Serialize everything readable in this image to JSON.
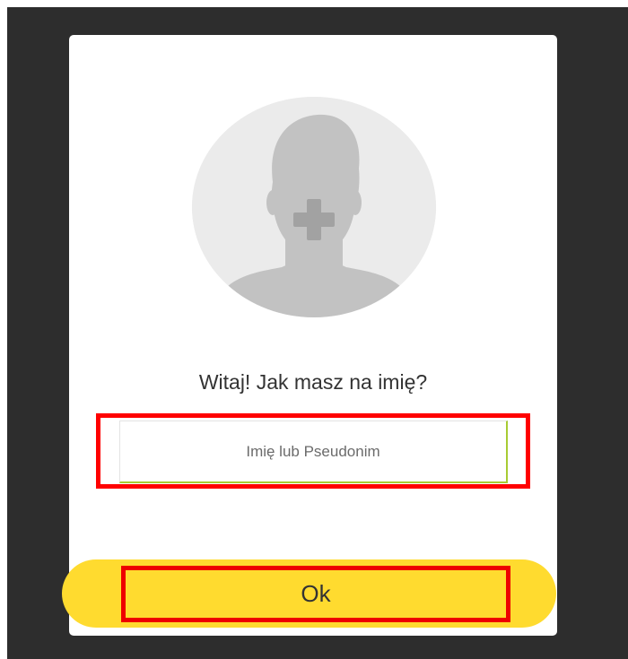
{
  "dialog": {
    "avatar": {
      "icon": "add-profile-photo-icon",
      "colors": {
        "background": "#ebebeb",
        "silhouette": "#c2c2c2",
        "plus": "#a2a2a2"
      }
    },
    "greeting": "Witaj! Jak masz na imię?",
    "name_input": {
      "value": "",
      "placeholder": "Imię lub Pseudonim"
    },
    "ok_button": {
      "label": "Ok",
      "color": "#ffdb2f"
    },
    "highlight_color": "#ff0000"
  },
  "backdrop_color": "#2d2d2d"
}
